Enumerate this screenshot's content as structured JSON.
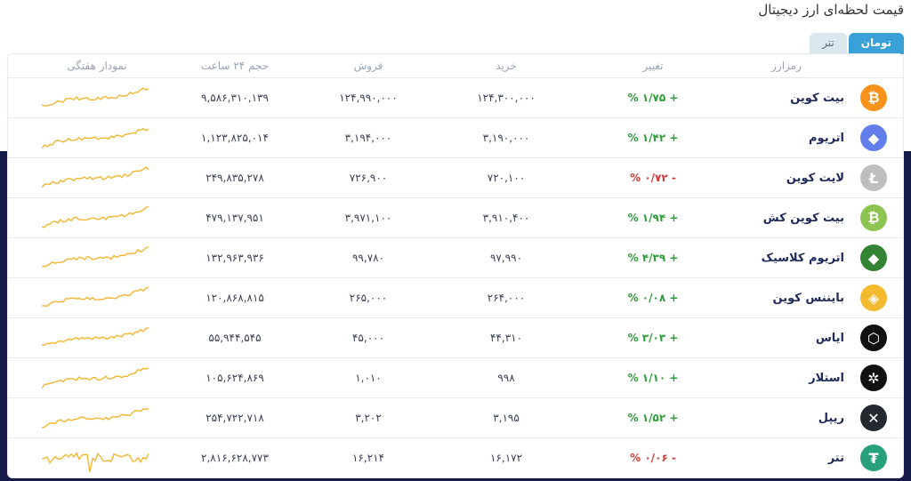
{
  "title": "قیمت لحظه‌ای ارز دیجیتال",
  "tabs": [
    {
      "label": "تومان",
      "active": true
    },
    {
      "label": "تتر",
      "active": false
    }
  ],
  "headers": {
    "market": "رمزارز",
    "change": "تغییر",
    "buy": "خرید",
    "sell": "فروش",
    "volume": "حجم ۲۴ ساعت",
    "chart": "نمودار هفتگی"
  },
  "colors": {
    "accent": "#3aa0d8",
    "up": "#2e9d3a",
    "down": "#d23a3a",
    "sparkline": "#f2b630",
    "band": "#161b49"
  },
  "rows": [
    {
      "name": "بیت کوین",
      "icon": "bitcoin-icon",
      "glyph": "₿",
      "color": "#f7931a",
      "change": "% ۱/۷۵ +",
      "dir": "up",
      "buy": "۱۲۴,۳۰۰,۰۰۰",
      "sell": "۱۲۴,۹۹۰,۰۰۰",
      "volume": "۹,۵۸۶,۳۱۰,۱۳۹"
    },
    {
      "name": "اتریوم",
      "icon": "ethereum-icon",
      "glyph": "◆",
      "color": "#627eea",
      "change": "% ۱/۴۲ +",
      "dir": "up",
      "buy": "۳,۱۹۰,۰۰۰",
      "sell": "۳,۱۹۴,۰۰۰",
      "volume": "۱,۱۲۳,۸۲۵,۰۱۴"
    },
    {
      "name": "لایت کوین",
      "icon": "litecoin-icon",
      "glyph": "Ł",
      "color": "#bebebe",
      "change": "% ۰/۷۲ -",
      "dir": "down",
      "buy": "۷۲۰,۱۰۰",
      "sell": "۷۲۶,۹۰۰",
      "volume": "۲۴۹,۸۳۵,۲۷۸"
    },
    {
      "name": "بیت کوین کش",
      "icon": "bitcoin-cash-icon",
      "glyph": "₿",
      "color": "#8dc351",
      "change": "% ۱/۹۴ +",
      "dir": "up",
      "buy": "۳,۹۱۰,۴۰۰",
      "sell": "۳,۹۷۱,۱۰۰",
      "volume": "۴۷۹,۱۳۷,۹۵۱"
    },
    {
      "name": "اتریوم کلاسیک",
      "icon": "ethereum-classic-icon",
      "glyph": "◆",
      "color": "#328332",
      "change": "% ۴/۳۹ +",
      "dir": "up",
      "buy": "۹۷,۹۹۰",
      "sell": "۹۹,۷۸۰",
      "volume": "۱۳۲,۹۶۳,۹۳۶"
    },
    {
      "name": "بایننس کوین",
      "icon": "binance-coin-icon",
      "glyph": "◈",
      "color": "#f3ba2f",
      "change": "% ۰/۰۸ +",
      "dir": "up",
      "buy": "۲۶۴,۰۰۰",
      "sell": "۲۶۵,۰۰۰",
      "volume": "۱۲۰,۸۶۸,۸۱۵"
    },
    {
      "name": "ایاس",
      "icon": "eos-icon",
      "glyph": "⬡",
      "color": "#111111",
      "change": "% ۳/۰۳ +",
      "dir": "up",
      "buy": "۴۴,۳۱۰",
      "sell": "۴۵,۰۰۰",
      "volume": "۵۵,۹۴۴,۵۴۵"
    },
    {
      "name": "استلار",
      "icon": "stellar-icon",
      "glyph": "✲",
      "color": "#111111",
      "change": "% ۱/۱۰ +",
      "dir": "up",
      "buy": "۹۹۸",
      "sell": "۱,۰۱۰",
      "volume": "۱۰۵,۶۲۴,۸۶۹"
    },
    {
      "name": "ریپل",
      "icon": "ripple-icon",
      "glyph": "✕",
      "color": "#23292f",
      "change": "% ۱/۵۲ +",
      "dir": "up",
      "buy": "۳,۱۹۵",
      "sell": "۳,۲۰۲",
      "volume": "۲۵۴,۷۲۲,۷۱۸"
    },
    {
      "name": "تتر",
      "icon": "tether-icon",
      "glyph": "₮",
      "color": "#26a17b",
      "change": "% ۰/۰۶ -",
      "dir": "down",
      "buy": "۱۶,۱۷۲",
      "sell": "۱۶,۲۱۴",
      "volume": "۲,۸۱۶,۶۲۸,۷۷۳"
    }
  ]
}
